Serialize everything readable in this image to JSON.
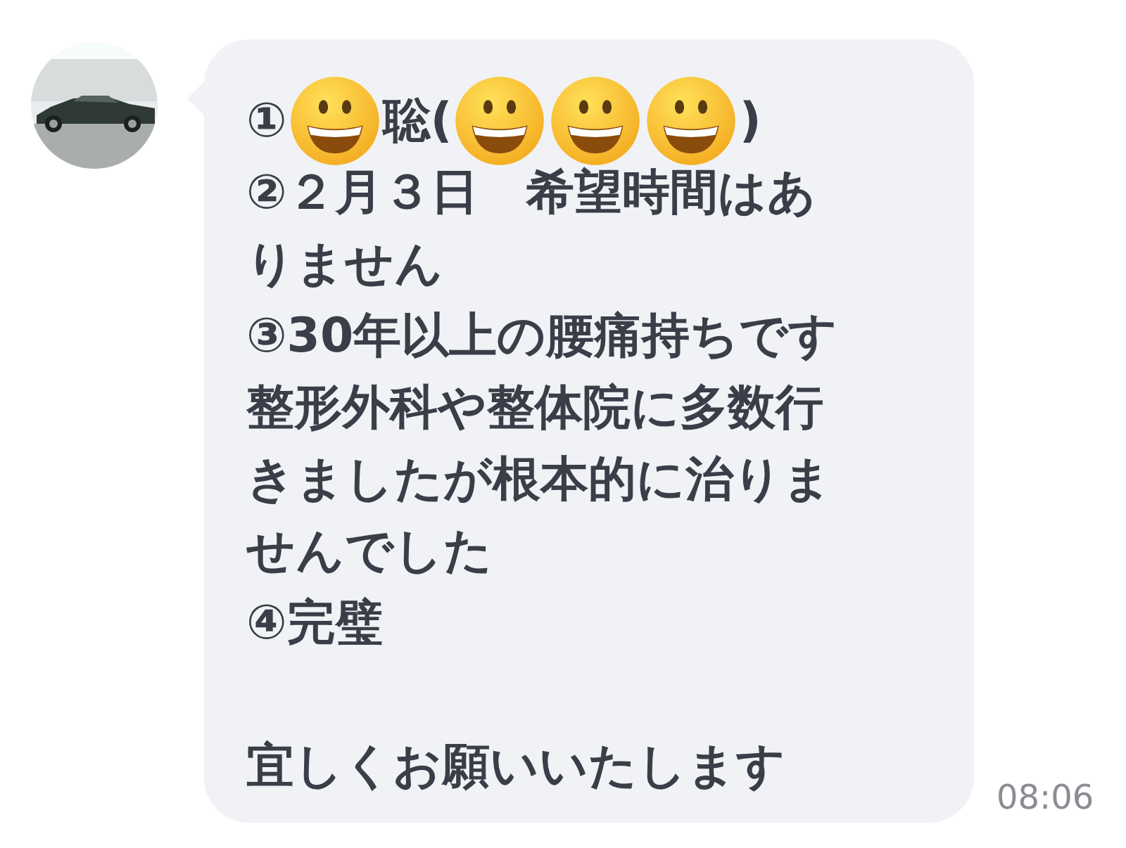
{
  "message": {
    "lines": [
      {
        "parts": [
          {
            "kind": "text",
            "text": "①"
          },
          {
            "kind": "sticker"
          },
          {
            "kind": "text",
            "text": "聡("
          },
          {
            "kind": "sticker"
          },
          {
            "kind": "sticker"
          },
          {
            "kind": "sticker"
          },
          {
            "kind": "text",
            "text": ")"
          }
        ]
      },
      {
        "parts": [
          {
            "kind": "text",
            "text": "②２月３日　希望時間はあ"
          }
        ]
      },
      {
        "parts": [
          {
            "kind": "text",
            "text": "りません"
          }
        ]
      },
      {
        "parts": [
          {
            "kind": "text",
            "text": "③30年以上の腰痛持ちです"
          }
        ]
      },
      {
        "parts": [
          {
            "kind": "text",
            "text": "整形外科や整体院に多数行"
          }
        ]
      },
      {
        "parts": [
          {
            "kind": "text",
            "text": "きましたが根本的に治りま"
          }
        ]
      },
      {
        "parts": [
          {
            "kind": "text",
            "text": "せんでした"
          }
        ]
      },
      {
        "parts": [
          {
            "kind": "text",
            "text": "④完璧"
          }
        ]
      }
    ],
    "closing": "宜しくお願いいたします"
  },
  "time": "08:06"
}
